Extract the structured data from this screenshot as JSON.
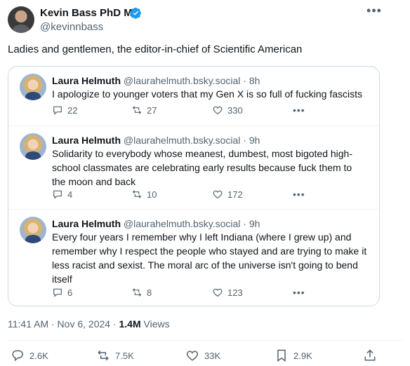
{
  "author": {
    "name": "Kevin Bass PhD MS",
    "handle": "@kevinnbass"
  },
  "tweet": {
    "text": "Ladies and gentlemen, the editor-in-chief of Scientific American",
    "time": "11:41 AM · Nov 6, 2024 · ",
    "views_count": "1.4M",
    "views_label": " Views"
  },
  "quotes": [
    {
      "name": "Laura Helmuth",
      "handle_time": " @laurahelmuth.bsky.social · 8h",
      "text": "I apologize to younger voters that my Gen X is so full of fucking fascists",
      "replies": "22",
      "reposts": "27",
      "likes": "330",
      "more": "•••"
    },
    {
      "name": "Laura Helmuth",
      "handle_time": " @laurahelmuth.bsky.social · 9h",
      "text": "Solidarity to everybody whose meanest, dumbest, most bigoted high-school classmates are celebrating early results because fuck them to the moon and back",
      "replies": "4",
      "reposts": "10",
      "likes": "172",
      "more": "•••"
    },
    {
      "name": "Laura Helmuth",
      "handle_time": " @laurahelmuth.bsky.social · 9h",
      "text": "Every four years I remember why I left Indiana (where I grew up) and remember why I respect the people who stayed and are trying to make it less racist and sexist. The moral arc of the universe isn't going to bend itself",
      "replies": "6",
      "reposts": "8",
      "likes": "123",
      "more": "•••"
    }
  ],
  "actions": {
    "replies": "2.6K",
    "reposts": "7.5K",
    "likes": "33K",
    "bookmarks": "2.9K"
  },
  "icons": {
    "verified": "verified-badge-icon",
    "more": "more-icon",
    "reply": "reply-icon",
    "repost": "repost-icon",
    "like": "heart-icon",
    "bookmark": "bookmark-icon",
    "share": "share-icon"
  },
  "colors": {
    "verified": "#1d9bf0",
    "text": "#0f1419",
    "secondary": "#536471",
    "border": "#cfd9de"
  }
}
